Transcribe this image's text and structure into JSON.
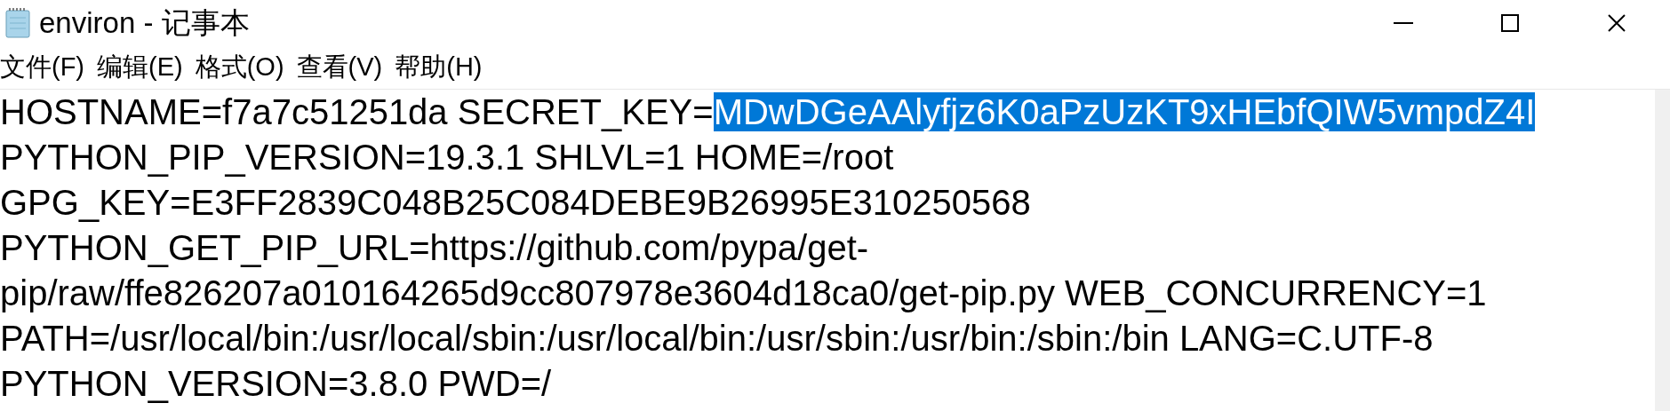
{
  "window": {
    "title": "environ - 记事本"
  },
  "menu": [
    {
      "label": "文件(F)"
    },
    {
      "label": "编辑(E)"
    },
    {
      "label": "格式(O)"
    },
    {
      "label": "查看(V)"
    },
    {
      "label": "帮助(H)"
    }
  ],
  "editor": {
    "lines": [
      [
        {
          "text": "HOSTNAME=f7a7c51251da SECRET_KEY=",
          "selected": false
        },
        {
          "text": "MDwDGeAAlyfjz6K0aPzUzKT9xHEbfQIW5vmpdZ4I",
          "selected": true
        }
      ],
      [
        {
          "text": "PYTHON_PIP_VERSION=19.3.1 SHLVL=1 HOME=/root",
          "selected": false
        }
      ],
      [
        {
          "text": "GPG_KEY=E3FF2839C048B25C084DEBE9B26995E310250568",
          "selected": false
        }
      ],
      [
        {
          "text": "PYTHON_GET_PIP_URL=https://github.com/pypa/get-",
          "selected": false
        }
      ],
      [
        {
          "text": "pip/raw/ffe826207a010164265d9cc807978e3604d18ca0/get-pip.py WEB_CONCURRENCY=1",
          "selected": false
        }
      ],
      [
        {
          "text": "PATH=/usr/local/bin:/usr/local/sbin:/usr/local/bin:/usr/sbin:/usr/bin:/sbin:/bin LANG=C.UTF-8",
          "selected": false
        }
      ],
      [
        {
          "text": "PYTHON_VERSION=3.8.0 PWD=/",
          "selected": false
        }
      ]
    ]
  }
}
